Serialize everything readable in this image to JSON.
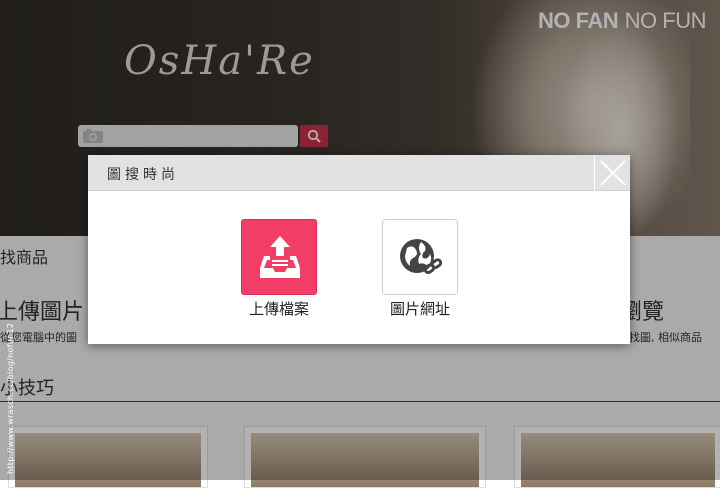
{
  "brand": {
    "bold": "NO FAN",
    "light": "NO FUN"
  },
  "logo": {
    "text": "OsHa'Re"
  },
  "search": {
    "placeholder": ""
  },
  "page": {
    "find_products": "找商品",
    "upload_image": "上傳圖片",
    "upload_desc": "從您電腦中的圖",
    "browse_heading": "瀏覽",
    "browse_desc": "圖找圖, 相似商品",
    "tips": "小技巧"
  },
  "dialog": {
    "title": "圖搜時尚",
    "options": [
      {
        "label": "上傳檔案",
        "icon": "upload-tray-icon",
        "color": "#f23e67"
      },
      {
        "label": "圖片網址",
        "icon": "globe-link-icon",
        "color": "#ffffff"
      }
    ]
  },
  "watermark": "http://www.wrasch.cc/blog/nofun12",
  "colors": {
    "accent": "#f23e67",
    "search_button": "#c9334d",
    "header_bg": "#e2e2e2"
  }
}
